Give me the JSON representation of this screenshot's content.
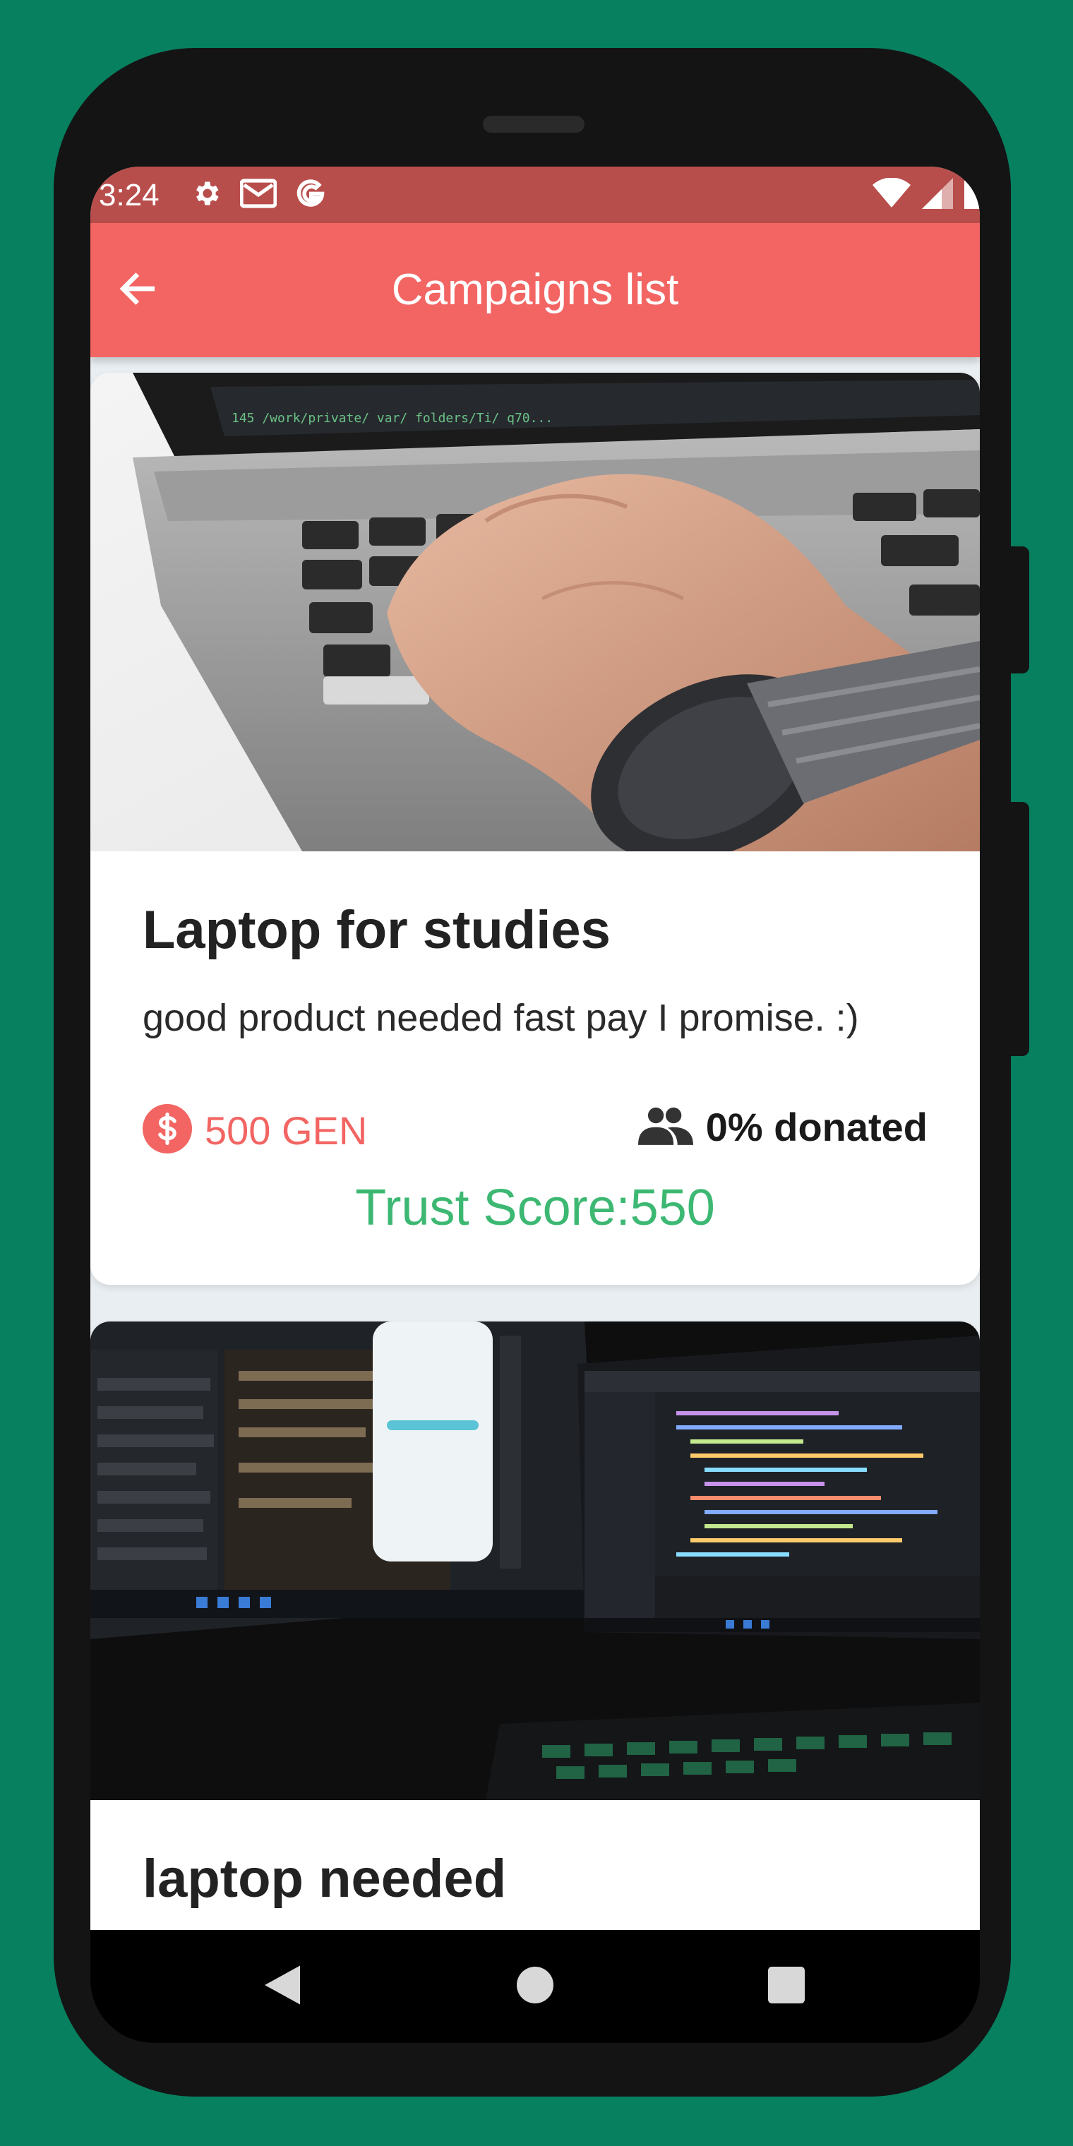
{
  "status_bar": {
    "time": "3:24",
    "icons_left": [
      "gear-icon",
      "gmail-icon",
      "google-icon"
    ],
    "icons_right": [
      "wifi-icon",
      "signal-icon",
      "battery-icon"
    ]
  },
  "app_bar": {
    "title": "Campaigns list",
    "back_icon": "arrow-back-icon"
  },
  "campaigns": [
    {
      "image": "laptop-typing-photo",
      "title": "Laptop for studies",
      "description": "good product needed fast pay I promise. :)",
      "amount": "500 GEN",
      "donated": "0% donated",
      "trust_score": "Trust Score:550"
    },
    {
      "image": "dual-monitor-desk-photo",
      "title": "laptop needed"
    }
  ],
  "nav": {
    "back": "nav-back-icon",
    "home": "nav-home-icon",
    "recents": "nav-recents-icon"
  },
  "colors": {
    "background": "#07805f",
    "accent": "#f26563",
    "status_bar": "#b84e4c",
    "trust_green": "#3db873"
  }
}
